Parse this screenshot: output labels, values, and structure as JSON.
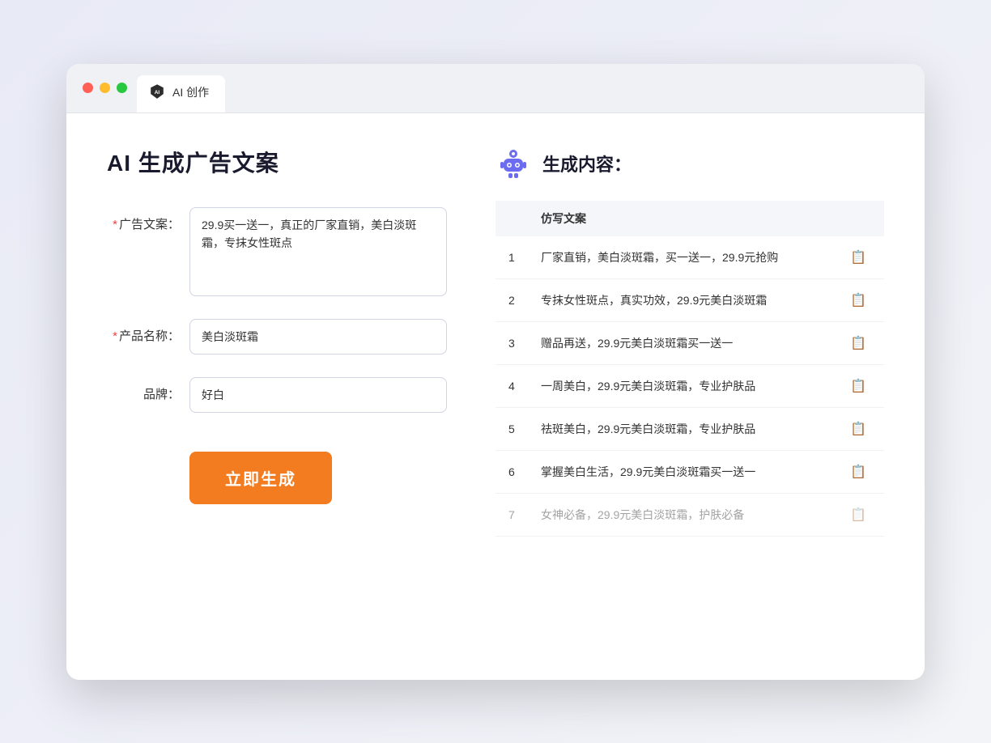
{
  "browser": {
    "tab_label": "AI 创作",
    "traffic_lights": [
      "red",
      "yellow",
      "green"
    ]
  },
  "left_panel": {
    "title": "AI 生成广告文案",
    "fields": [
      {
        "id": "ad_copy",
        "label": "广告文案：",
        "required": true,
        "type": "textarea",
        "value": "29.9买一送一，真正的厂家直销，美白淡斑霜，专抹女性斑点"
      },
      {
        "id": "product_name",
        "label": "产品名称：",
        "required": true,
        "type": "input",
        "value": "美白淡斑霜"
      },
      {
        "id": "brand",
        "label": "品牌：",
        "required": false,
        "type": "input",
        "value": "好白"
      }
    ],
    "button_label": "立即生成"
  },
  "right_panel": {
    "title": "生成内容：",
    "table_header": "仿写文案",
    "results": [
      {
        "num": "1",
        "text": "厂家直销，美白淡斑霜，买一送一，29.9元抢购"
      },
      {
        "num": "2",
        "text": "专抹女性斑点，真实功效，29.9元美白淡斑霜"
      },
      {
        "num": "3",
        "text": "赠品再送，29.9元美白淡斑霜买一送一"
      },
      {
        "num": "4",
        "text": "一周美白，29.9元美白淡斑霜，专业护肤品"
      },
      {
        "num": "5",
        "text": "祛斑美白，29.9元美白淡斑霜，专业护肤品"
      },
      {
        "num": "6",
        "text": "掌握美白生活，29.9元美白淡斑霜买一送一"
      },
      {
        "num": "7",
        "text": "女神必备，29.9元美白淡斑霜，护肤必备"
      }
    ]
  }
}
